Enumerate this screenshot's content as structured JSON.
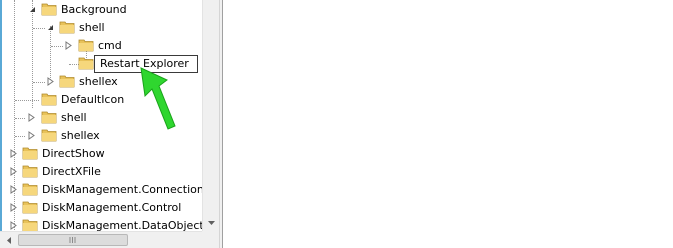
{
  "tree": {
    "items": [
      {
        "label": "Background",
        "state": "expanded"
      },
      {
        "label": "shell",
        "state": "expanded"
      },
      {
        "label": "cmd",
        "state": "collapsed"
      },
      {
        "label": "Restart Explorer",
        "state": "editing"
      },
      {
        "label": "shellex",
        "state": "collapsed"
      },
      {
        "label": "DefaultIcon",
        "state": "leaf"
      },
      {
        "label": "shell",
        "state": "collapsed"
      },
      {
        "label": "shellex",
        "state": "collapsed"
      },
      {
        "label": "DirectShow",
        "state": "collapsed"
      },
      {
        "label": "DirectXFile",
        "state": "collapsed"
      },
      {
        "label": "DiskManagement.Connection",
        "state": "collapsed"
      },
      {
        "label": "DiskManagement.Control",
        "state": "collapsed"
      },
      {
        "label": "DiskManagement.DataObject",
        "state": "collapsed"
      }
    ]
  },
  "icons": {
    "folder": "folder-icon",
    "expanded": "expanded-triangle-icon",
    "collapsed": "collapsed-triangle-icon",
    "annotation": "green-arrow-icon"
  },
  "colors": {
    "folder": "#e8c25a",
    "arrow": "#2fd62f",
    "edge": "#5aa9d6"
  }
}
